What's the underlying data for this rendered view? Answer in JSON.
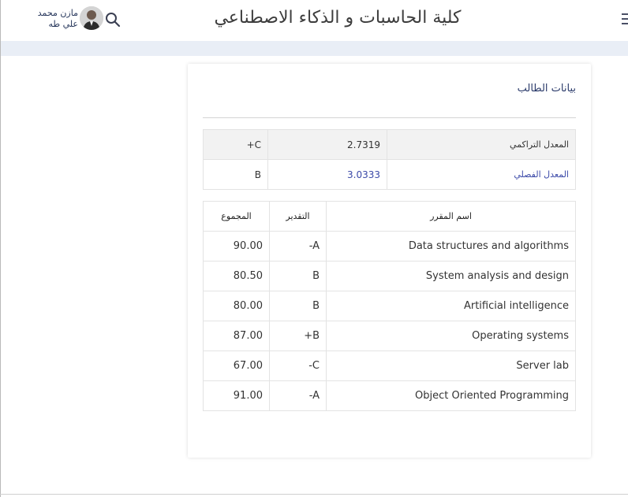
{
  "header": {
    "title": "كلية الحاسبات و الذكاء الاصطناعي",
    "user_name_line1": "مازن محمد",
    "user_name_line2": "علي طه",
    "icons": [
      "menu-icon",
      "search-icon",
      "avatar"
    ]
  },
  "student_data": {
    "section_title": "بيانات الطالب",
    "cumulative_gpa": {
      "label": "المعدل التراكمي",
      "value": "2.7319",
      "grade": "+C"
    },
    "semester_gpa": {
      "label": "المعدل الفصلي",
      "value": "3.0333",
      "grade": "B"
    }
  },
  "courses": {
    "headers": {
      "name": "اسم المقرر",
      "grade": "التقدير",
      "total": "المجموع"
    },
    "rows": [
      {
        "name": "Data structures and algorithms",
        "grade": "-A",
        "total": "90.00"
      },
      {
        "name": "System analysis and design",
        "grade": "B",
        "total": "80.50"
      },
      {
        "name": "Artificial intelligence",
        "grade": "B",
        "total": "80.00"
      },
      {
        "name": "Operating systems",
        "grade": "+B",
        "total": "87.00"
      },
      {
        "name": "Server lab",
        "grade": "-C",
        "total": "67.00"
      },
      {
        "name": "Object Oriented Programming",
        "grade": "-A",
        "total": "91.00"
      }
    ]
  },
  "colors": {
    "accent_blue": "#3b49a8",
    "band": "#e9eef6",
    "header_text": "#3d3d3d"
  }
}
